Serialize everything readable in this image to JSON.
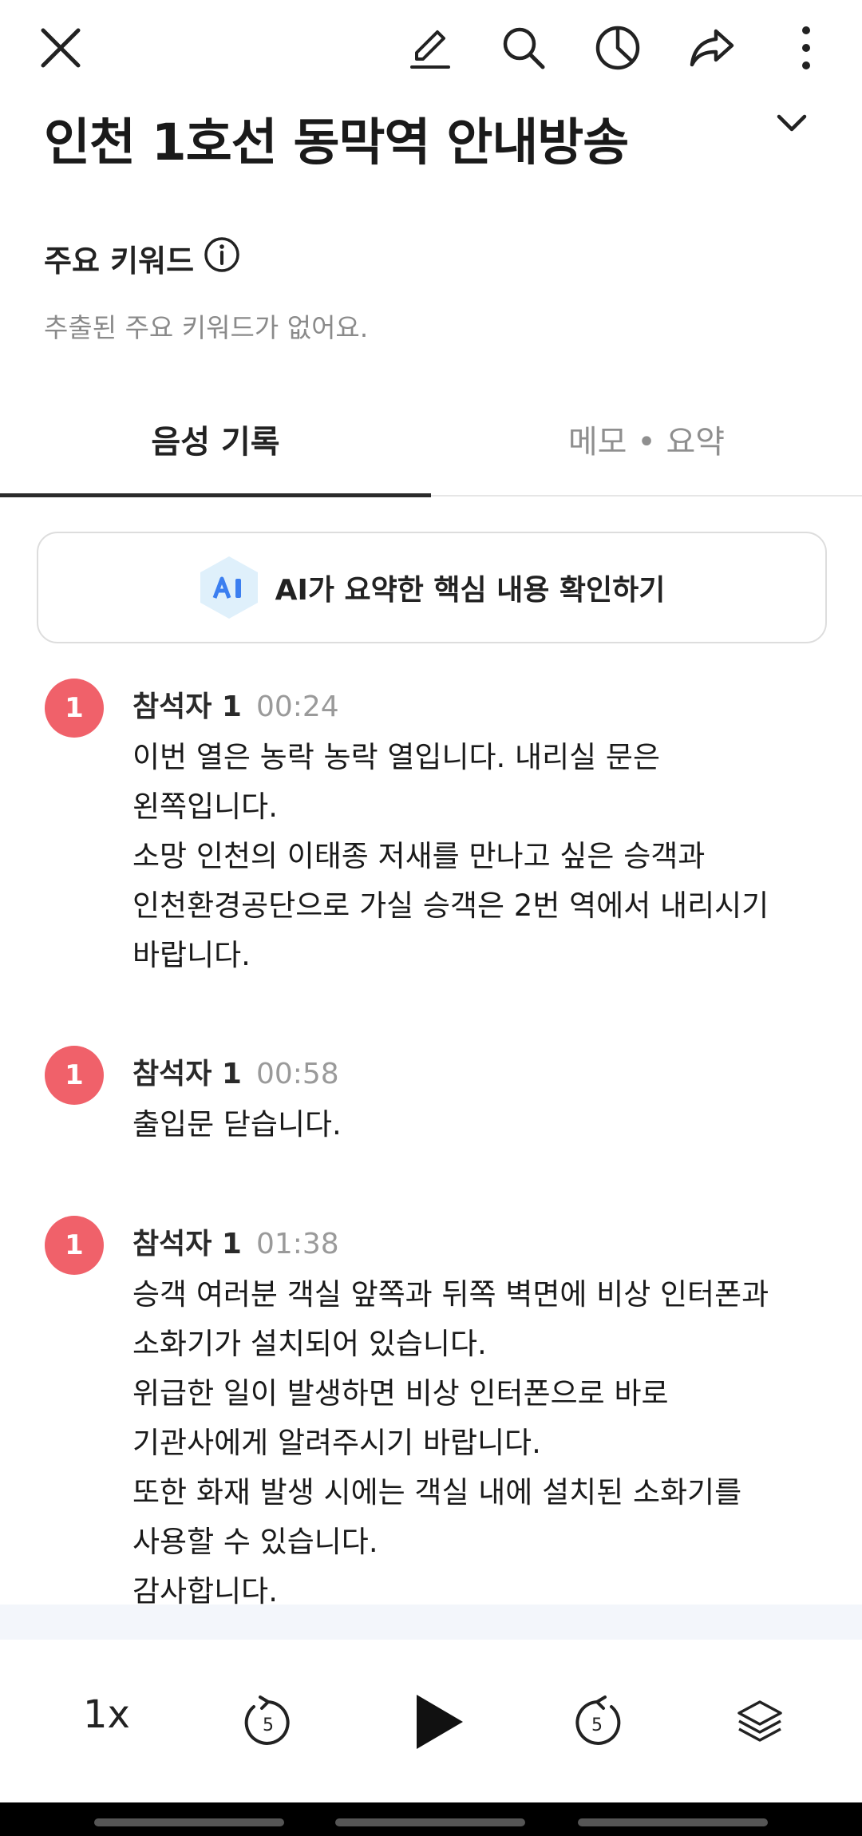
{
  "toolbar": {
    "close": "close-icon",
    "edit": "pencil-icon",
    "search": "search-icon",
    "stats": "pie-chart-icon",
    "share": "share-icon",
    "more": "more-vertical-icon"
  },
  "header": {
    "title": "인천 1호선 동막역 안내방송"
  },
  "keywords": {
    "label": "주요 키워드",
    "empty_text": "추출된 주요 키워드가 없어요."
  },
  "tabs": [
    {
      "label": "음성 기록",
      "active": true
    },
    {
      "label": "메모 • 요약",
      "active": false
    }
  ],
  "ai_summary": {
    "badge": "AI",
    "label": "AI가 요약한 핵심 내용 확인하기"
  },
  "transcript": [
    {
      "avatar": "1",
      "speaker": "참석자 1",
      "time": "00:24",
      "text": "이번 열은 농락 농락 열입니다. 내리실 문은\n왼쪽입니다.\n소망 인천의 이태종 저새를 만나고 싶은 승객과\n인천환경공단으로 가실 승객은 2번 역에서 내리시기\n바랍니다."
    },
    {
      "avatar": "1",
      "speaker": "참석자 1",
      "time": "00:58",
      "text": "출입문 닫습니다."
    },
    {
      "avatar": "1",
      "speaker": "참석자 1",
      "time": "01:38",
      "text": "승객 여러분 객실 앞쪽과 뒤쪽 벽면에 비상 인터폰과\n소화기가 설치되어 있습니다.\n위급한 일이 발생하면 비상 인터폰으로 바로\n기관사에게 알려주시기 바랍니다.\n또한 화재 발생 시에는 객실 내에 설치된 소화기를\n사용할 수 있습니다.\n감사합니다."
    }
  ],
  "player": {
    "speed": "1x",
    "skip_seconds": "5",
    "rewind": "replay-5-icon",
    "play": "play-icon",
    "forward": "forward-5-icon",
    "layers": "layers-icon"
  },
  "colors": {
    "accent_tab": "#2b2b2b",
    "avatar": "#f0616a",
    "ai_badge": "#4a86f0"
  }
}
